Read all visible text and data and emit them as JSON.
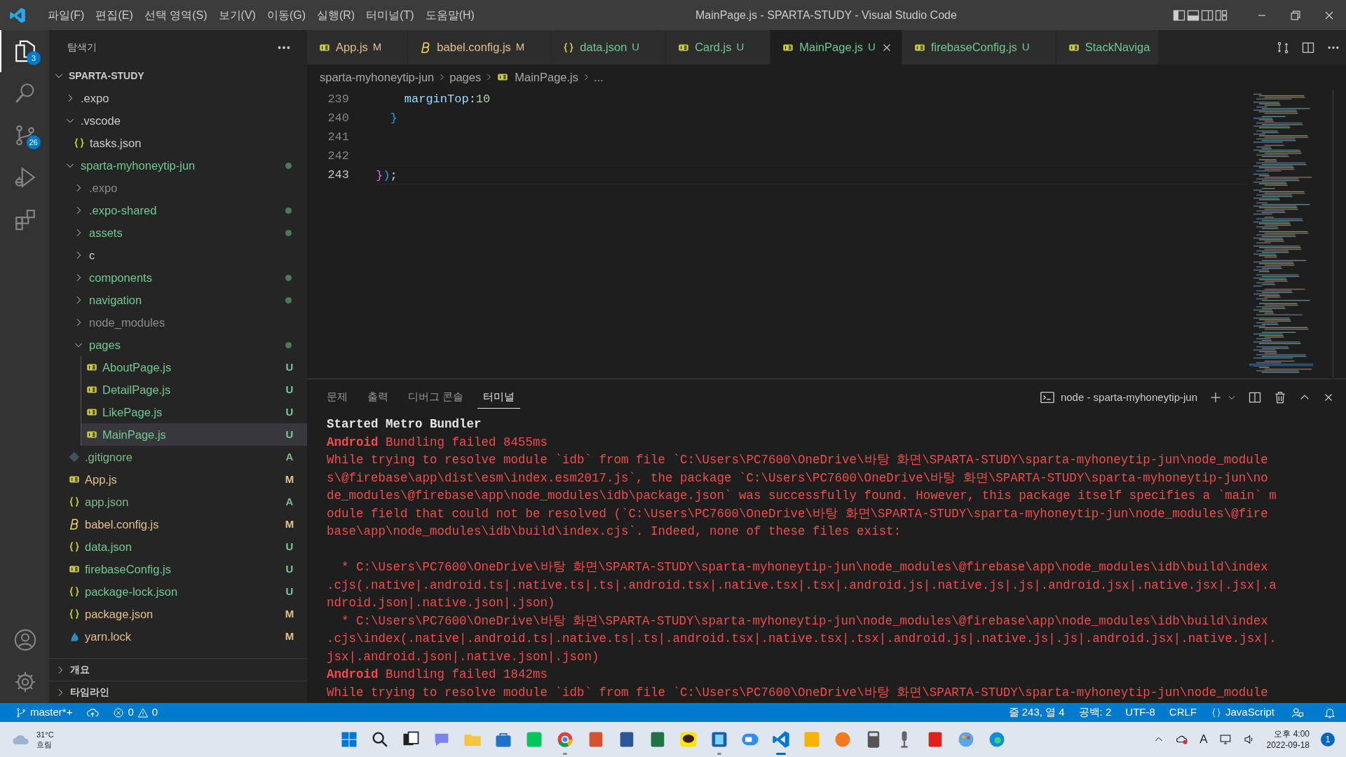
{
  "window": {
    "title": "MainPage.js - SPARTA-STUDY - Visual Studio Code"
  },
  "menu": [
    "파일(F)",
    "편집(E)",
    "선택 영역(S)",
    "보기(V)",
    "이동(G)",
    "실행(R)",
    "터미널(T)",
    "도움말(H)"
  ],
  "activity_bar": {
    "top": [
      {
        "kind": "explorer",
        "selected": true,
        "badge": "3"
      },
      {
        "kind": "search",
        "selected": false
      },
      {
        "kind": "scm",
        "selected": false,
        "badge": "26"
      },
      {
        "kind": "debug",
        "selected": false
      },
      {
        "kind": "extensions",
        "selected": false
      }
    ],
    "bottom": [
      {
        "kind": "account"
      },
      {
        "kind": "settings"
      }
    ]
  },
  "sidebar": {
    "title": "탐색기",
    "root": {
      "name": "SPARTA-STUDY",
      "expanded": true
    },
    "tree": [
      {
        "name": ".expo",
        "kind": "folder",
        "color": "#cccccc",
        "expanded": false,
        "selected": false
      },
      {
        "name": ".vscode",
        "kind": "folder",
        "color": "#cccccc",
        "expanded": true,
        "selected": false,
        "children": [
          {
            "name": "tasks.json",
            "kind": "json",
            "color": "#cccccc",
            "selected": false
          }
        ]
      },
      {
        "name": "sparta-myhoneytip-jun",
        "kind": "folder",
        "color": "#73c991",
        "expanded": true,
        "dot": true,
        "selected": false,
        "children": [
          {
            "name": ".expo",
            "kind": "folder",
            "color": "#8c8c8c",
            "expanded": false,
            "selected": false
          },
          {
            "name": ".expo-shared",
            "kind": "folder",
            "color": "#73c991",
            "expanded": false,
            "dot": true,
            "selected": false
          },
          {
            "name": "assets",
            "kind": "folder",
            "color": "#73c991",
            "expanded": false,
            "dot": true,
            "selected": false
          },
          {
            "name": "c",
            "kind": "folder",
            "color": "#cccccc",
            "expanded": false,
            "selected": false
          },
          {
            "name": "components",
            "kind": "folder",
            "color": "#73c991",
            "expanded": false,
            "dot": true,
            "selected": false
          },
          {
            "name": "navigation",
            "kind": "folder",
            "color": "#73c991",
            "expanded": false,
            "dot": true,
            "selected": false
          },
          {
            "name": "node_modules",
            "kind": "folder",
            "color": "#8c8c8c",
            "expanded": false,
            "selected": false
          },
          {
            "name": "pages",
            "kind": "folder",
            "color": "#73c991",
            "expanded": true,
            "dot": true,
            "selected": false,
            "children": [
              {
                "name": "AboutPage.js",
                "kind": "js",
                "color": "#73c991",
                "badge": "U",
                "selected": false
              },
              {
                "name": "DetailPage.js",
                "kind": "js",
                "color": "#73c991",
                "badge": "U",
                "selected": false
              },
              {
                "name": "LikePage.js",
                "kind": "js",
                "color": "#73c991",
                "badge": "U",
                "selected": false
              },
              {
                "name": "MainPage.js",
                "kind": "js",
                "color": "#73c991",
                "badge": "U",
                "selected": true
              }
            ]
          }
        ]
      },
      {
        "name": ".gitignore",
        "kind": "git",
        "color": "#81b88b",
        "badge": "A",
        "selected": false
      },
      {
        "name": "App.js",
        "kind": "js",
        "color": "#e2c08d",
        "badge": "M",
        "selected": false
      },
      {
        "name": "app.json",
        "kind": "json",
        "color": "#81b88b",
        "badge": "A",
        "selected": false
      },
      {
        "name": "babel.config.js",
        "kind": "babel",
        "color": "#e2c08d",
        "badge": "M",
        "selected": false
      },
      {
        "name": "data.json",
        "kind": "json",
        "color": "#73c991",
        "badge": "U",
        "selected": false
      },
      {
        "name": "firebaseConfig.js",
        "kind": "js",
        "color": "#73c991",
        "badge": "U",
        "selected": false
      },
      {
        "name": "package-lock.json",
        "kind": "json",
        "color": "#73c991",
        "badge": "U",
        "selected": false
      },
      {
        "name": "package.json",
        "kind": "json",
        "color": "#e2c08d",
        "badge": "M",
        "selected": false
      },
      {
        "name": "yarn.lock",
        "kind": "yarn",
        "color": "#e2c08d",
        "badge": "M",
        "selected": false
      }
    ],
    "sections": [
      {
        "title": "개요",
        "expanded": false
      },
      {
        "title": "타임라인",
        "expanded": false
      }
    ]
  },
  "tabs": [
    {
      "label": "App.js",
      "kind": "js",
      "color": "#e2c08d",
      "badge": "M",
      "selected": false
    },
    {
      "label": "babel.config.js",
      "kind": "babel",
      "color": "#e2c08d",
      "badge": "M",
      "selected": false
    },
    {
      "label": "data.json",
      "kind": "json",
      "color": "#73c991",
      "badge": "U",
      "selected": false
    },
    {
      "label": "Card.js",
      "kind": "js",
      "color": "#73c991",
      "badge": "U",
      "selected": false
    },
    {
      "label": "MainPage.js",
      "kind": "js",
      "color": "#73c991",
      "badge": "U",
      "selected": true
    },
    {
      "label": "firebaseConfig.js",
      "kind": "js",
      "color": "#73c991",
      "badge": "U",
      "selected": false
    },
    {
      "label": "StackNaviga",
      "kind": "js",
      "color": "#73c991",
      "selected": false
    }
  ],
  "breadcrumbs": [
    {
      "label": "sparta-myhoneytip-jun",
      "kind": "folder"
    },
    {
      "label": "pages",
      "kind": "folder"
    },
    {
      "label": "MainPage.js",
      "kind": "js"
    },
    {
      "label": "...",
      "kind": "more"
    }
  ],
  "editor": {
    "lines": [
      {
        "number": "239",
        "current": false,
        "tokens": [
          {
            "text": "    marginTop",
            "kind": "property"
          },
          {
            "text": ":",
            "kind": "punct"
          },
          {
            "text": "10",
            "kind": "number"
          }
        ]
      },
      {
        "number": "240",
        "current": false,
        "tokens": [
          {
            "text": "  }",
            "kind": "brace2"
          }
        ]
      },
      {
        "number": "241",
        "current": false
      },
      {
        "number": "242",
        "current": false
      },
      {
        "number": "243",
        "current": true,
        "tokens": [
          {
            "text": "}",
            "kind": "brace1"
          },
          {
            "text": ")",
            "kind": "brace2"
          },
          {
            "text": ";",
            "kind": "punct"
          }
        ]
      }
    ]
  },
  "panel": {
    "tabs": [
      {
        "label": "문제",
        "selected": false
      },
      {
        "label": "출력",
        "selected": false
      },
      {
        "label": "디버그 콘솔",
        "selected": false
      },
      {
        "label": "터미널",
        "selected": true
      }
    ],
    "terminal_name": "node - sparta-myhoneytip-jun",
    "terminal_lines": [
      {
        "kind": "heading",
        "text": "Started Metro Bundler"
      },
      {
        "kind": "error",
        "text": "**Android** Bundling failed 8455ms"
      },
      {
        "kind": "error",
        "text": "While trying to resolve module `idb` from file `C:\\Users\\PC7600\\OneDrive\\바탕 화면\\SPARTA-STUDY\\sparta-myhoneytip-jun\\node_module"
      },
      {
        "kind": "error",
        "text": "s\\@firebase\\app\\dist\\esm\\index.esm2017.js`, the package `C:\\Users\\PC7600\\OneDrive\\바탕 화면\\SPARTA-STUDY\\sparta-myhoneytip-jun\\no"
      },
      {
        "kind": "error",
        "text": "de_modules\\@firebase\\app\\node_modules\\idb\\package.json` was successfully found. However, this package itself specifies a `main` m"
      },
      {
        "kind": "error",
        "text": "odule field that could not be resolved (`C:\\Users\\PC7600\\OneDrive\\바탕 화면\\SPARTA-STUDY\\sparta-myhoneytip-jun\\node_modules\\@fire"
      },
      {
        "kind": "error",
        "text": "base\\app\\node_modules\\idb\\build\\index.cjs`. Indeed, none of these files exist:"
      },
      {
        "kind": "blank"
      },
      {
        "kind": "error",
        "text": "  * C:\\Users\\PC7600\\OneDrive\\바탕 화면\\SPARTA-STUDY\\sparta-myhoneytip-jun\\node_modules\\@firebase\\app\\node_modules\\idb\\build\\index"
      },
      {
        "kind": "error",
        "text": ".cjs(.native|.android.ts|.native.ts|.ts|.android.tsx|.native.tsx|.tsx|.android.js|.native.js|.js|.android.jsx|.native.jsx|.jsx|.a"
      },
      {
        "kind": "error",
        "text": "ndroid.json|.native.json|.json)"
      },
      {
        "kind": "error",
        "text": "  * C:\\Users\\PC7600\\OneDrive\\바탕 화면\\SPARTA-STUDY\\sparta-myhoneytip-jun\\node_modules\\@firebase\\app\\node_modules\\idb\\build\\index"
      },
      {
        "kind": "error",
        "text": ".cjs\\index(.native|.android.ts|.native.ts|.ts|.android.tsx|.native.tsx|.tsx|.android.js|.native.js|.js|.android.jsx|.native.jsx|."
      },
      {
        "kind": "error",
        "text": "jsx|.android.json|.native.json|.json)"
      },
      {
        "kind": "error",
        "text": "**Android** Bundling failed 1842ms"
      },
      {
        "kind": "error",
        "text": "While trying to resolve module `idb` from file `C:\\Users\\PC7600\\OneDrive\\바탕 화면\\SPARTA-STUDY\\sparta-myhoneytip-jun\\node_module"
      }
    ]
  },
  "status_bar": {
    "left": [
      {
        "kind": "branch",
        "text": "master*+"
      },
      {
        "kind": "sync"
      },
      {
        "kind": "problems",
        "errors": "0",
        "warnings": "0"
      }
    ],
    "right": [
      {
        "kind": "text",
        "text": "줄 243, 열 4"
      },
      {
        "kind": "text",
        "text": "공백: 2"
      },
      {
        "kind": "text",
        "text": "UTF-8"
      },
      {
        "kind": "text",
        "text": "CRLF"
      },
      {
        "kind": "language",
        "text": "JavaScript"
      },
      {
        "kind": "feedback"
      },
      {
        "kind": "bell"
      }
    ]
  },
  "taskbar": {
    "weather": {
      "temp": "31°C",
      "condition": "흐림"
    },
    "apps": [
      {
        "kind": "windows",
        "running": false
      },
      {
        "kind": "search",
        "running": false
      },
      {
        "kind": "taskview",
        "running": false
      },
      {
        "kind": "chat",
        "running": false
      },
      {
        "kind": "files",
        "running": false
      },
      {
        "kind": "store",
        "running": false
      },
      {
        "kind": "naver",
        "running": false
      },
      {
        "kind": "chrome",
        "running": true
      },
      {
        "kind": "powerpoint",
        "running": false
      },
      {
        "kind": "word",
        "running": false
      },
      {
        "kind": "excel",
        "running": false
      },
      {
        "kind": "talk",
        "running": false
      },
      {
        "kind": "terminal",
        "running": true
      },
      {
        "kind": "zoom",
        "running": false
      },
      {
        "kind": "vscode",
        "running": true,
        "selected": true
      },
      {
        "kind": "hangul",
        "running": false
      },
      {
        "kind": "orange",
        "running": false
      },
      {
        "kind": "calculator",
        "running": false
      },
      {
        "kind": "mic",
        "running": false
      },
      {
        "kind": "acrobat",
        "running": false
      },
      {
        "kind": "paint",
        "running": false
      },
      {
        "kind": "edge",
        "running": false
      }
    ],
    "ime": "A",
    "time": "오후 4:00",
    "date": "2022-09-18",
    "notifications": "1"
  }
}
